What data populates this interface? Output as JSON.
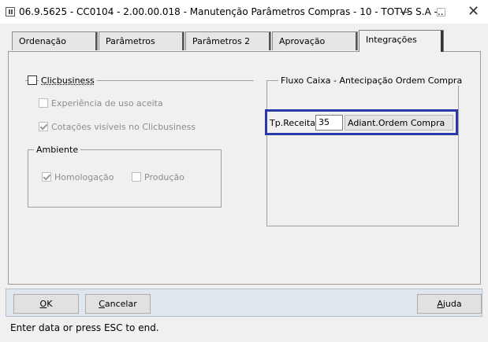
{
  "window": {
    "title": "06.9.5625 - CC0104 - 2.00.00.018 - Manutenção Parâmetros Compras - 10 - TOTVS S.A -..."
  },
  "tabs": [
    {
      "label": "Ordenação"
    },
    {
      "label": "Parâmetros"
    },
    {
      "label": "Parâmetros 2"
    },
    {
      "label": "Aprovação"
    },
    {
      "label": "Integrações",
      "active": true
    }
  ],
  "clicbusiness": {
    "toggle_label": "Clicbusiness",
    "experiencia_label": "Experiência de uso aceita",
    "cotacoes_label": "Cotações visíveis no Clicbusiness",
    "ambiente": {
      "title": "Ambiente",
      "homologacao_label": "Homologação",
      "producao_label": "Produção"
    }
  },
  "fluxo_caixa": {
    "title": "Fluxo Caixa - Antecipação Ordem Compra",
    "tp_receita_label": "Tp.Receita:",
    "tp_receita_value": "35",
    "tp_receita_desc": "Adiant.Ordem Compra"
  },
  "buttons": {
    "ok_mnemonic": "O",
    "ok_rest": "K",
    "cancel_mnemonic": "C",
    "cancel_rest": "ancelar",
    "help_mnemonic": "A",
    "help_rest": "juda"
  },
  "status_bar": {
    "text": "Enter data or press ESC to end."
  }
}
